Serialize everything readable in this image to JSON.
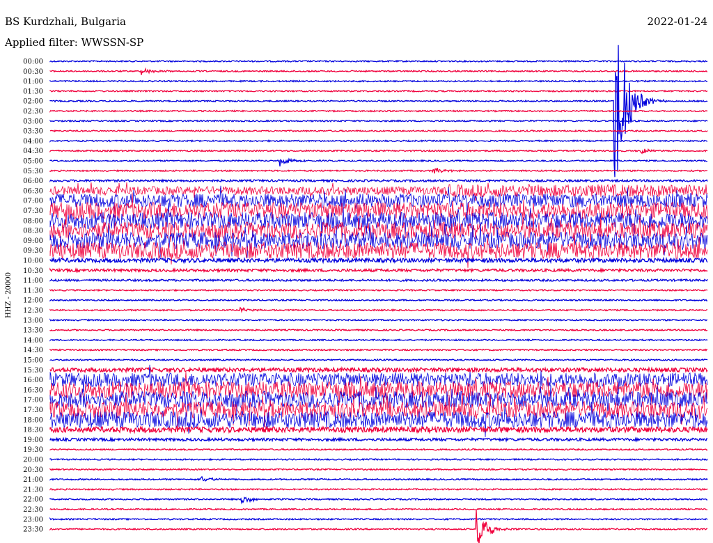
{
  "header": {
    "station": "BS Kurdzhali, Bulgaria",
    "date": "2022-01-24",
    "filter": "Applied filter: WWSSN-SP"
  },
  "chart_data": {
    "type": "line",
    "title": "BS Kurdzhali, Bulgaria",
    "subtitle": "Applied filter: WWSSN-SP",
    "date": "2022-01-24",
    "ylabel": "HHZ - 20000",
    "xlabel": "",
    "trace_colors": [
      "#0000dd",
      "#f0003c"
    ],
    "row_labels": [
      "00:00",
      "00:30",
      "01:00",
      "01:30",
      "02:00",
      "02:30",
      "03:00",
      "03:30",
      "04:00",
      "04:30",
      "05:00",
      "05:30",
      "06:00",
      "06:30",
      "07:00",
      "07:30",
      "08:00",
      "08:30",
      "09:00",
      "09:30",
      "10:00",
      "10:30",
      "11:00",
      "11:30",
      "12:00",
      "12:30",
      "13:00",
      "13:30",
      "14:00",
      "14:30",
      "15:00",
      "15:30",
      "16:00",
      "16:30",
      "17:00",
      "17:30",
      "18:00",
      "18:30",
      "19:00",
      "19:30",
      "20:00",
      "20:30",
      "21:00",
      "21:30",
      "22:00",
      "22:30",
      "23:00",
      "23:30"
    ],
    "noise_amplitude": [
      1,
      1,
      1,
      1,
      1,
      1,
      1,
      1,
      1,
      1,
      1,
      1,
      1.5,
      6,
      10,
      12,
      12,
      12,
      12,
      12,
      3,
      2,
      1.5,
      1,
      1,
      1,
      1,
      1,
      1,
      1,
      1,
      3,
      10,
      12,
      12,
      12,
      12,
      4,
      2,
      1,
      1,
      1,
      1,
      1,
      1,
      1,
      1,
      1
    ],
    "events": [
      {
        "row": 4,
        "minute": 25.8,
        "amplitude": 150
      },
      {
        "row": 47,
        "minute": 19.5,
        "amplitude": 30
      },
      {
        "row": 10,
        "minute": 10.5,
        "amplitude": 8
      },
      {
        "row": 44,
        "minute": 8.8,
        "amplitude": 6
      },
      {
        "row": 1,
        "minute": 4.2,
        "amplitude": 5
      },
      {
        "row": 42,
        "minute": 6.9,
        "amplitude": 5
      },
      {
        "row": 11,
        "minute": 17.5,
        "amplitude": 5
      },
      {
        "row": 9,
        "minute": 27,
        "amplitude": 4
      },
      {
        "row": 25,
        "minute": 8.7,
        "amplitude": 4
      }
    ]
  }
}
